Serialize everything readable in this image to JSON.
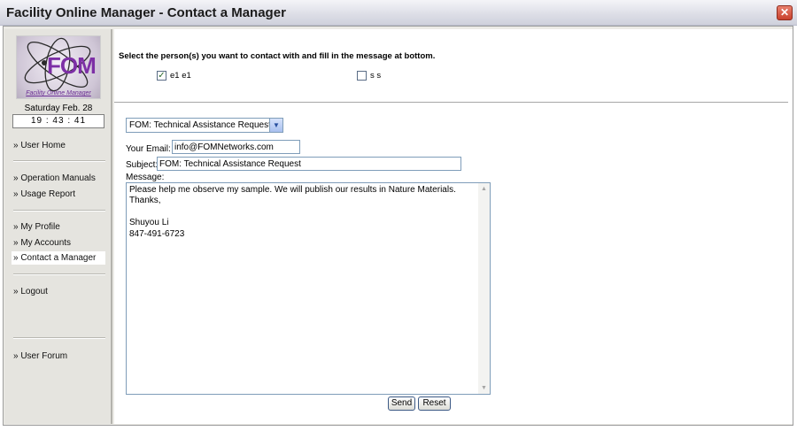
{
  "window": {
    "title": "Facility Online Manager - Contact a Manager",
    "close_glyph": "✕"
  },
  "logo": {
    "text": "FOM",
    "subtitle": "Facility Online Manager"
  },
  "sidebar": {
    "date": "Saturday Feb. 28",
    "time": "19 : 43 : 41",
    "items": [
      {
        "label": "» User Home"
      },
      {
        "label": "» Operation Manuals"
      },
      {
        "label": "» Usage Report"
      },
      {
        "label": "» My Profile"
      },
      {
        "label": "» My Accounts"
      },
      {
        "label": "» Contact a Manager",
        "active": true
      },
      {
        "label": "» Logout"
      },
      {
        "label": "» User Forum"
      }
    ]
  },
  "main": {
    "instruction": "Select the person(s) you want to contact with and fill in the message at bottom.",
    "recipients": [
      {
        "label": "e1 e1",
        "checked": true
      },
      {
        "label": "s s",
        "checked": false
      }
    ],
    "check_glyph": "✓",
    "request_type": {
      "selected": "FOM: Technical Assistance Request",
      "arrow_glyph": "▼"
    },
    "email": {
      "label": "Your Email:",
      "value": "info@FOMNetworks.com"
    },
    "subject": {
      "label": "Subject:",
      "value": "FOM: Technical Assistance Request"
    },
    "message": {
      "label": "Message:",
      "value": "Please help me observe my sample. We will publish our results in Nature Materials.\nThanks,\n\nShuyou Li\n847-491-6723",
      "scroll_up_glyph": "▲",
      "scroll_down_glyph": "▼"
    },
    "buttons": {
      "send": "Send",
      "reset": "Reset"
    }
  },
  "colors": {
    "logo_purple": "#7d2fa6",
    "close_red": "#c9412d",
    "input_border": "#7f9db9"
  }
}
